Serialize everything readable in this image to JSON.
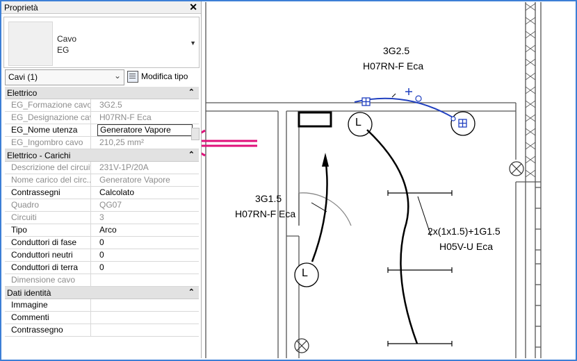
{
  "panel": {
    "title": "Proprietà",
    "close_glyph": "✕",
    "type_line1": "Cavo",
    "type_line2": "EG",
    "selector_value": "Cavi (1)",
    "edit_type_label": "Modifica tipo"
  },
  "sections": [
    {
      "title": "Elettrico",
      "collapse_glyph": "⌃",
      "rows": [
        {
          "key": "EG_Formazione cavo",
          "value": "3G2.5",
          "disabled": true
        },
        {
          "key": "EG_Designazione cavo",
          "value": "H07RN-F  Eca",
          "disabled": true
        },
        {
          "key": "EG_Nome utenza",
          "value": "Generatore Vapore",
          "disabled": false,
          "editing": true
        },
        {
          "key": "EG_Ingombro cavo",
          "value": "210,25 mm²",
          "disabled": true
        }
      ]
    },
    {
      "title": "Elettrico - Carichi",
      "collapse_glyph": "⌃",
      "rows": [
        {
          "key": "Descrizione del circuito",
          "value": "231V-1P/20A",
          "disabled": true
        },
        {
          "key": "Nome carico del circ...",
          "value": "Generatore Vapore",
          "disabled": true
        },
        {
          "key": "Contrassegni",
          "value": "Calcolato",
          "disabled": false
        },
        {
          "key": "Quadro",
          "value": "QG07",
          "disabled": true
        },
        {
          "key": "Circuiti",
          "value": "3",
          "disabled": true
        },
        {
          "key": "Tipo",
          "value": "Arco",
          "disabled": false
        },
        {
          "key": "Conduttori di fase",
          "value": "0",
          "disabled": false
        },
        {
          "key": "Conduttori neutri",
          "value": "0",
          "disabled": false
        },
        {
          "key": "Conduttori di terra",
          "value": "0",
          "disabled": false
        },
        {
          "key": "Dimensione cavo",
          "value": "",
          "disabled": true
        }
      ]
    },
    {
      "title": "Dati identità",
      "collapse_glyph": "⌃",
      "rows": [
        {
          "key": "Immagine",
          "value": "",
          "disabled": false
        },
        {
          "key": "Commenti",
          "value": "",
          "disabled": false
        },
        {
          "key": "Contrassegno",
          "value": "",
          "disabled": false
        }
      ]
    }
  ],
  "drawing": {
    "label_top_1": "3G2.5",
    "label_top_2": "H07RN-F  Eca",
    "label_left_1": "3G1.5",
    "label_left_2": "H07RN-F  Eca",
    "label_right_1": "2x(1x1.5)+1G1.5",
    "label_right_2": "H05V-U  Eca",
    "symbol_letter": "L",
    "colors": {
      "selection": "#1f3fbf",
      "arrow": "#e0107a",
      "frame": "#3c7fd6"
    }
  }
}
